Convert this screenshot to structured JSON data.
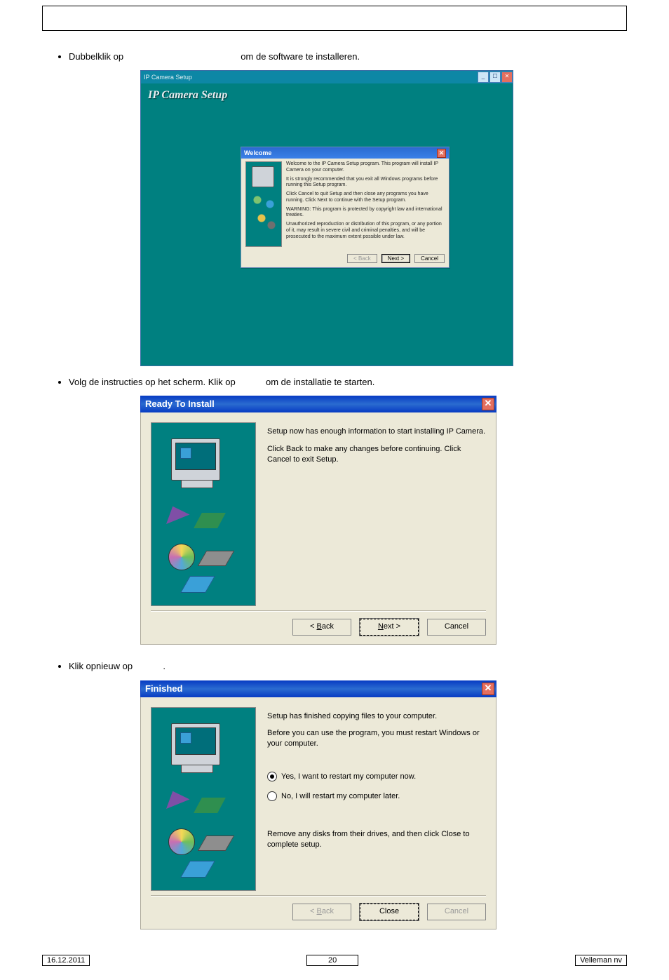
{
  "document": {
    "bullet1_a": "Dubbelklik op",
    "bullet1_b": "om de software te installeren.",
    "bullet2_a": "Volg de instructies op het scherm. Klik op",
    "bullet2_b": "om de installatie te starten.",
    "bullet3_a": "Klik opnieuw op",
    "bullet3_b": "."
  },
  "scr1": {
    "app_title": "IP Camera Setup",
    "heading": "IP Camera Setup",
    "welcome_title": "Welcome",
    "para1": "Welcome to the IP Camera Setup program. This program will install IP Camera on your computer.",
    "para2": "It is strongly recommended that you exit all Windows programs before running this Setup program.",
    "para3": "Click Cancel to quit Setup and then close any programs you have running. Click Next to continue with the Setup program.",
    "para4": "WARNING: This program is protected by copyright law and international treaties.",
    "para5": "Unauthorized reproduction or distribution of this program, or any portion of it, may result in severe civil and criminal penalties, and will be prosecuted to the maximum extent possible under law.",
    "btn_back": "< Back",
    "btn_next": "Next >",
    "btn_cancel": "Cancel"
  },
  "scr2": {
    "title": "Ready To Install",
    "para1": "Setup now has enough information to start installing IP Camera.",
    "para2": "Click Back to make any changes before continuing. Click Cancel to exit Setup.",
    "btn_back_display": "< Back",
    "btn_next_display": "Next >",
    "btn_cancel": "Cancel"
  },
  "scr3": {
    "title": "Finished",
    "para1": "Setup has finished copying files to your computer.",
    "para2": "Before you can use the program, you must restart Windows or your computer.",
    "radio_yes": "Yes, I want to restart my computer now.",
    "radio_no": "No, I will restart my computer later.",
    "para3": "Remove any disks from their drives, and then click Close to complete setup.",
    "btn_back_display": "< Back",
    "btn_close": "Close",
    "btn_cancel": "Cancel"
  },
  "footer": {
    "date": "16.12.2011",
    "page": "20",
    "company": "Velleman nv"
  }
}
